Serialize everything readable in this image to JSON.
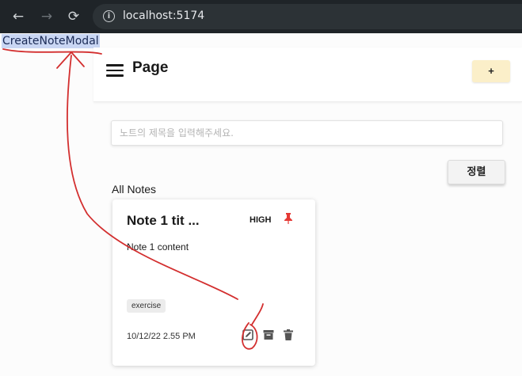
{
  "browser": {
    "back_icon": "←",
    "forward_icon": "→",
    "reload_icon": "⟳",
    "url": "localhost:5174"
  },
  "selection_text": "CreateNoteModal",
  "header": {
    "title": "Page",
    "add_label": "+"
  },
  "search": {
    "placeholder": "노트의 제목을 입력해주세요."
  },
  "sort_label": "정렬",
  "notes_section_title": "All Notes",
  "note": {
    "title": "Note 1 tit ...",
    "priority": "HIGH",
    "content": "Note 1 content",
    "tag": "exercise",
    "date": "10/12/22 2.55 PM"
  },
  "colors": {
    "pin": "#e53935",
    "annotation": "#d32f2f",
    "add_button_bg": "#fbefc9"
  }
}
